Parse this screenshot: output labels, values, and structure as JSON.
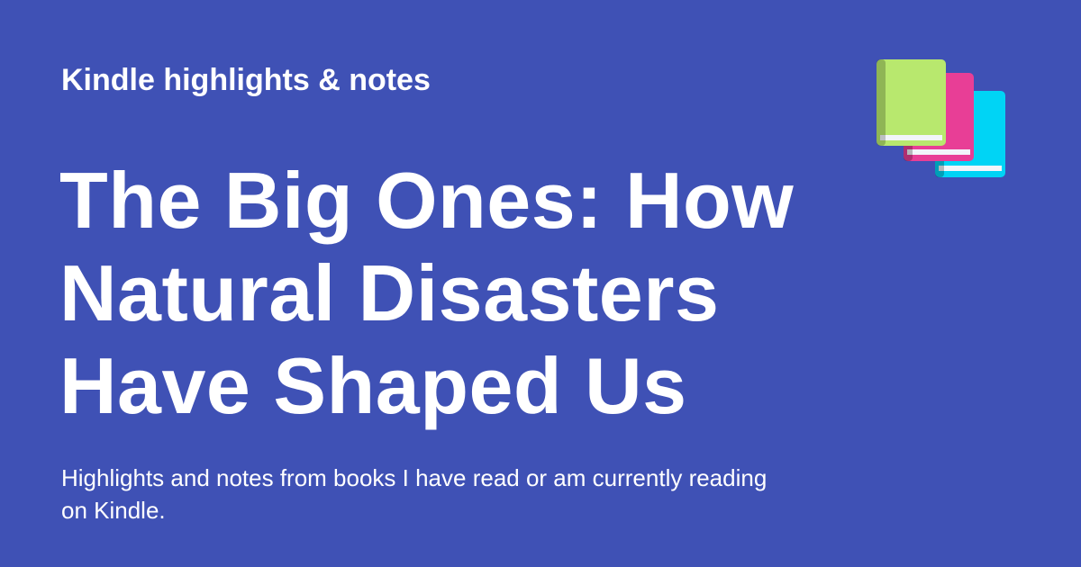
{
  "colors": {
    "background": "#3f51b5",
    "text": "#ffffff",
    "book_green": "#b8e86e",
    "book_pink": "#e83e96",
    "book_cyan": "#00d4f5"
  },
  "header": {
    "eyebrow": "Kindle highlights & notes"
  },
  "main": {
    "title": "The Big Ones: How Natural Disasters Have Shaped Us",
    "description": "Highlights and notes from books I have read or am currently reading on Kindle."
  },
  "icons": {
    "books": "books-stack-icon"
  }
}
